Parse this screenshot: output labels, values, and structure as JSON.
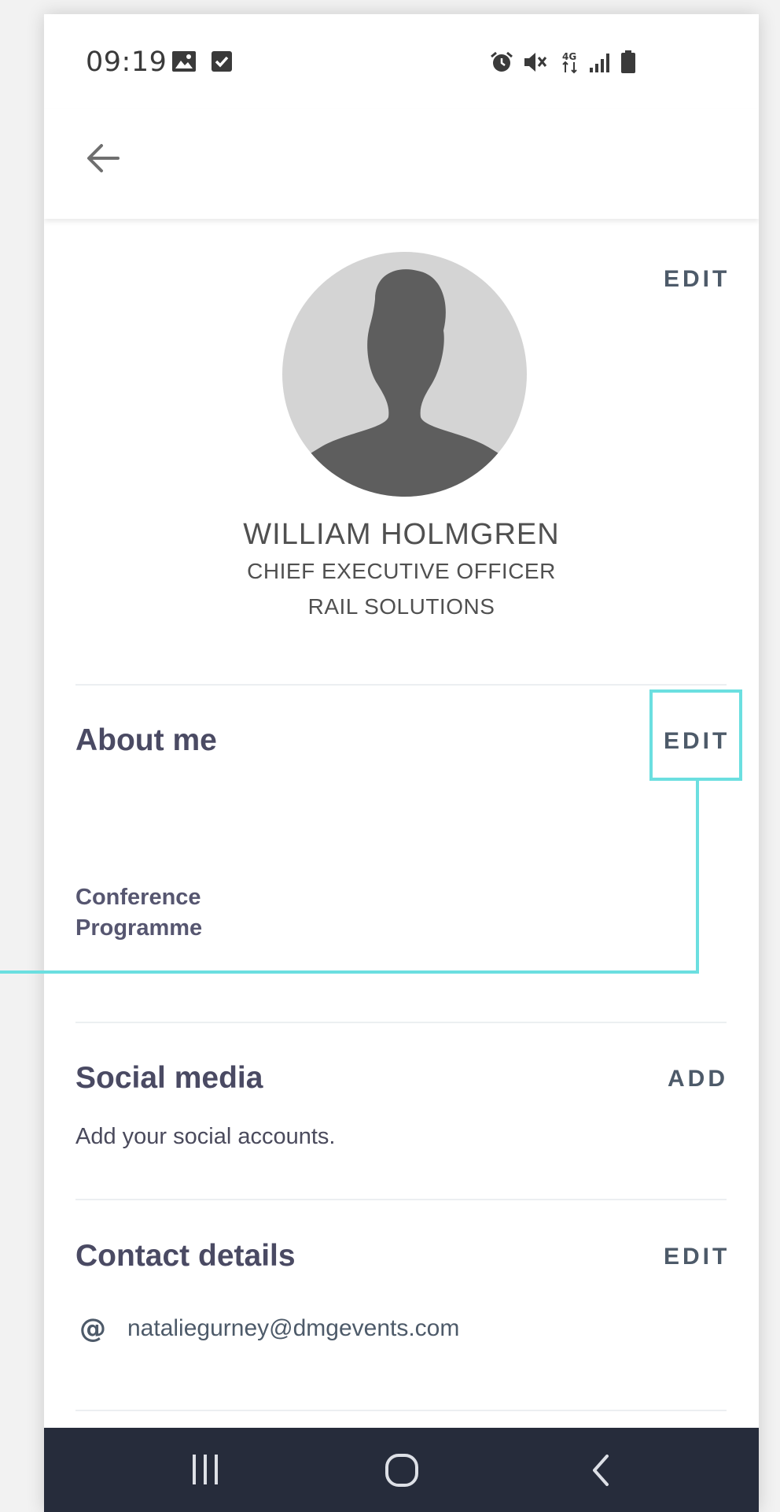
{
  "status_bar": {
    "time": "09:19",
    "left_icons": [
      "image-icon",
      "checkbox-icon"
    ],
    "right_icons": [
      "alarm-icon",
      "mute-icon",
      "network-4g-icon",
      "signal-icon",
      "battery-icon"
    ],
    "network_label": "4G"
  },
  "app_bar": {
    "back_icon": "arrow-left-icon"
  },
  "profile": {
    "edit_label": "EDIT",
    "name": "WILLIAM HOLMGREN",
    "job_title": "CHIEF EXECUTIVE OFFICER",
    "company": "RAIL SOLUTIONS"
  },
  "about": {
    "title": "About me",
    "edit_label": "EDIT",
    "programme_line1": "Conference",
    "programme_line2": "Programme"
  },
  "social": {
    "title": "Social media",
    "add_label": "ADD",
    "subtitle": "Add your social accounts."
  },
  "contact": {
    "title": "Contact details",
    "edit_label": "EDIT",
    "email": "nataliegurney@dmgevents.com",
    "email_icon": "at-icon"
  },
  "nav_bar": {
    "buttons": [
      "recent-apps-icon",
      "home-icon",
      "back-icon"
    ]
  },
  "colors": {
    "accent_highlight": "#6bdfe0",
    "nav_bar_bg": "#262c3b",
    "heading_text": "#4a4a63",
    "link_text": "#4d5a69",
    "avatar_bg": "#d4d4d4",
    "avatar_silhouette": "#5e5e5e"
  }
}
